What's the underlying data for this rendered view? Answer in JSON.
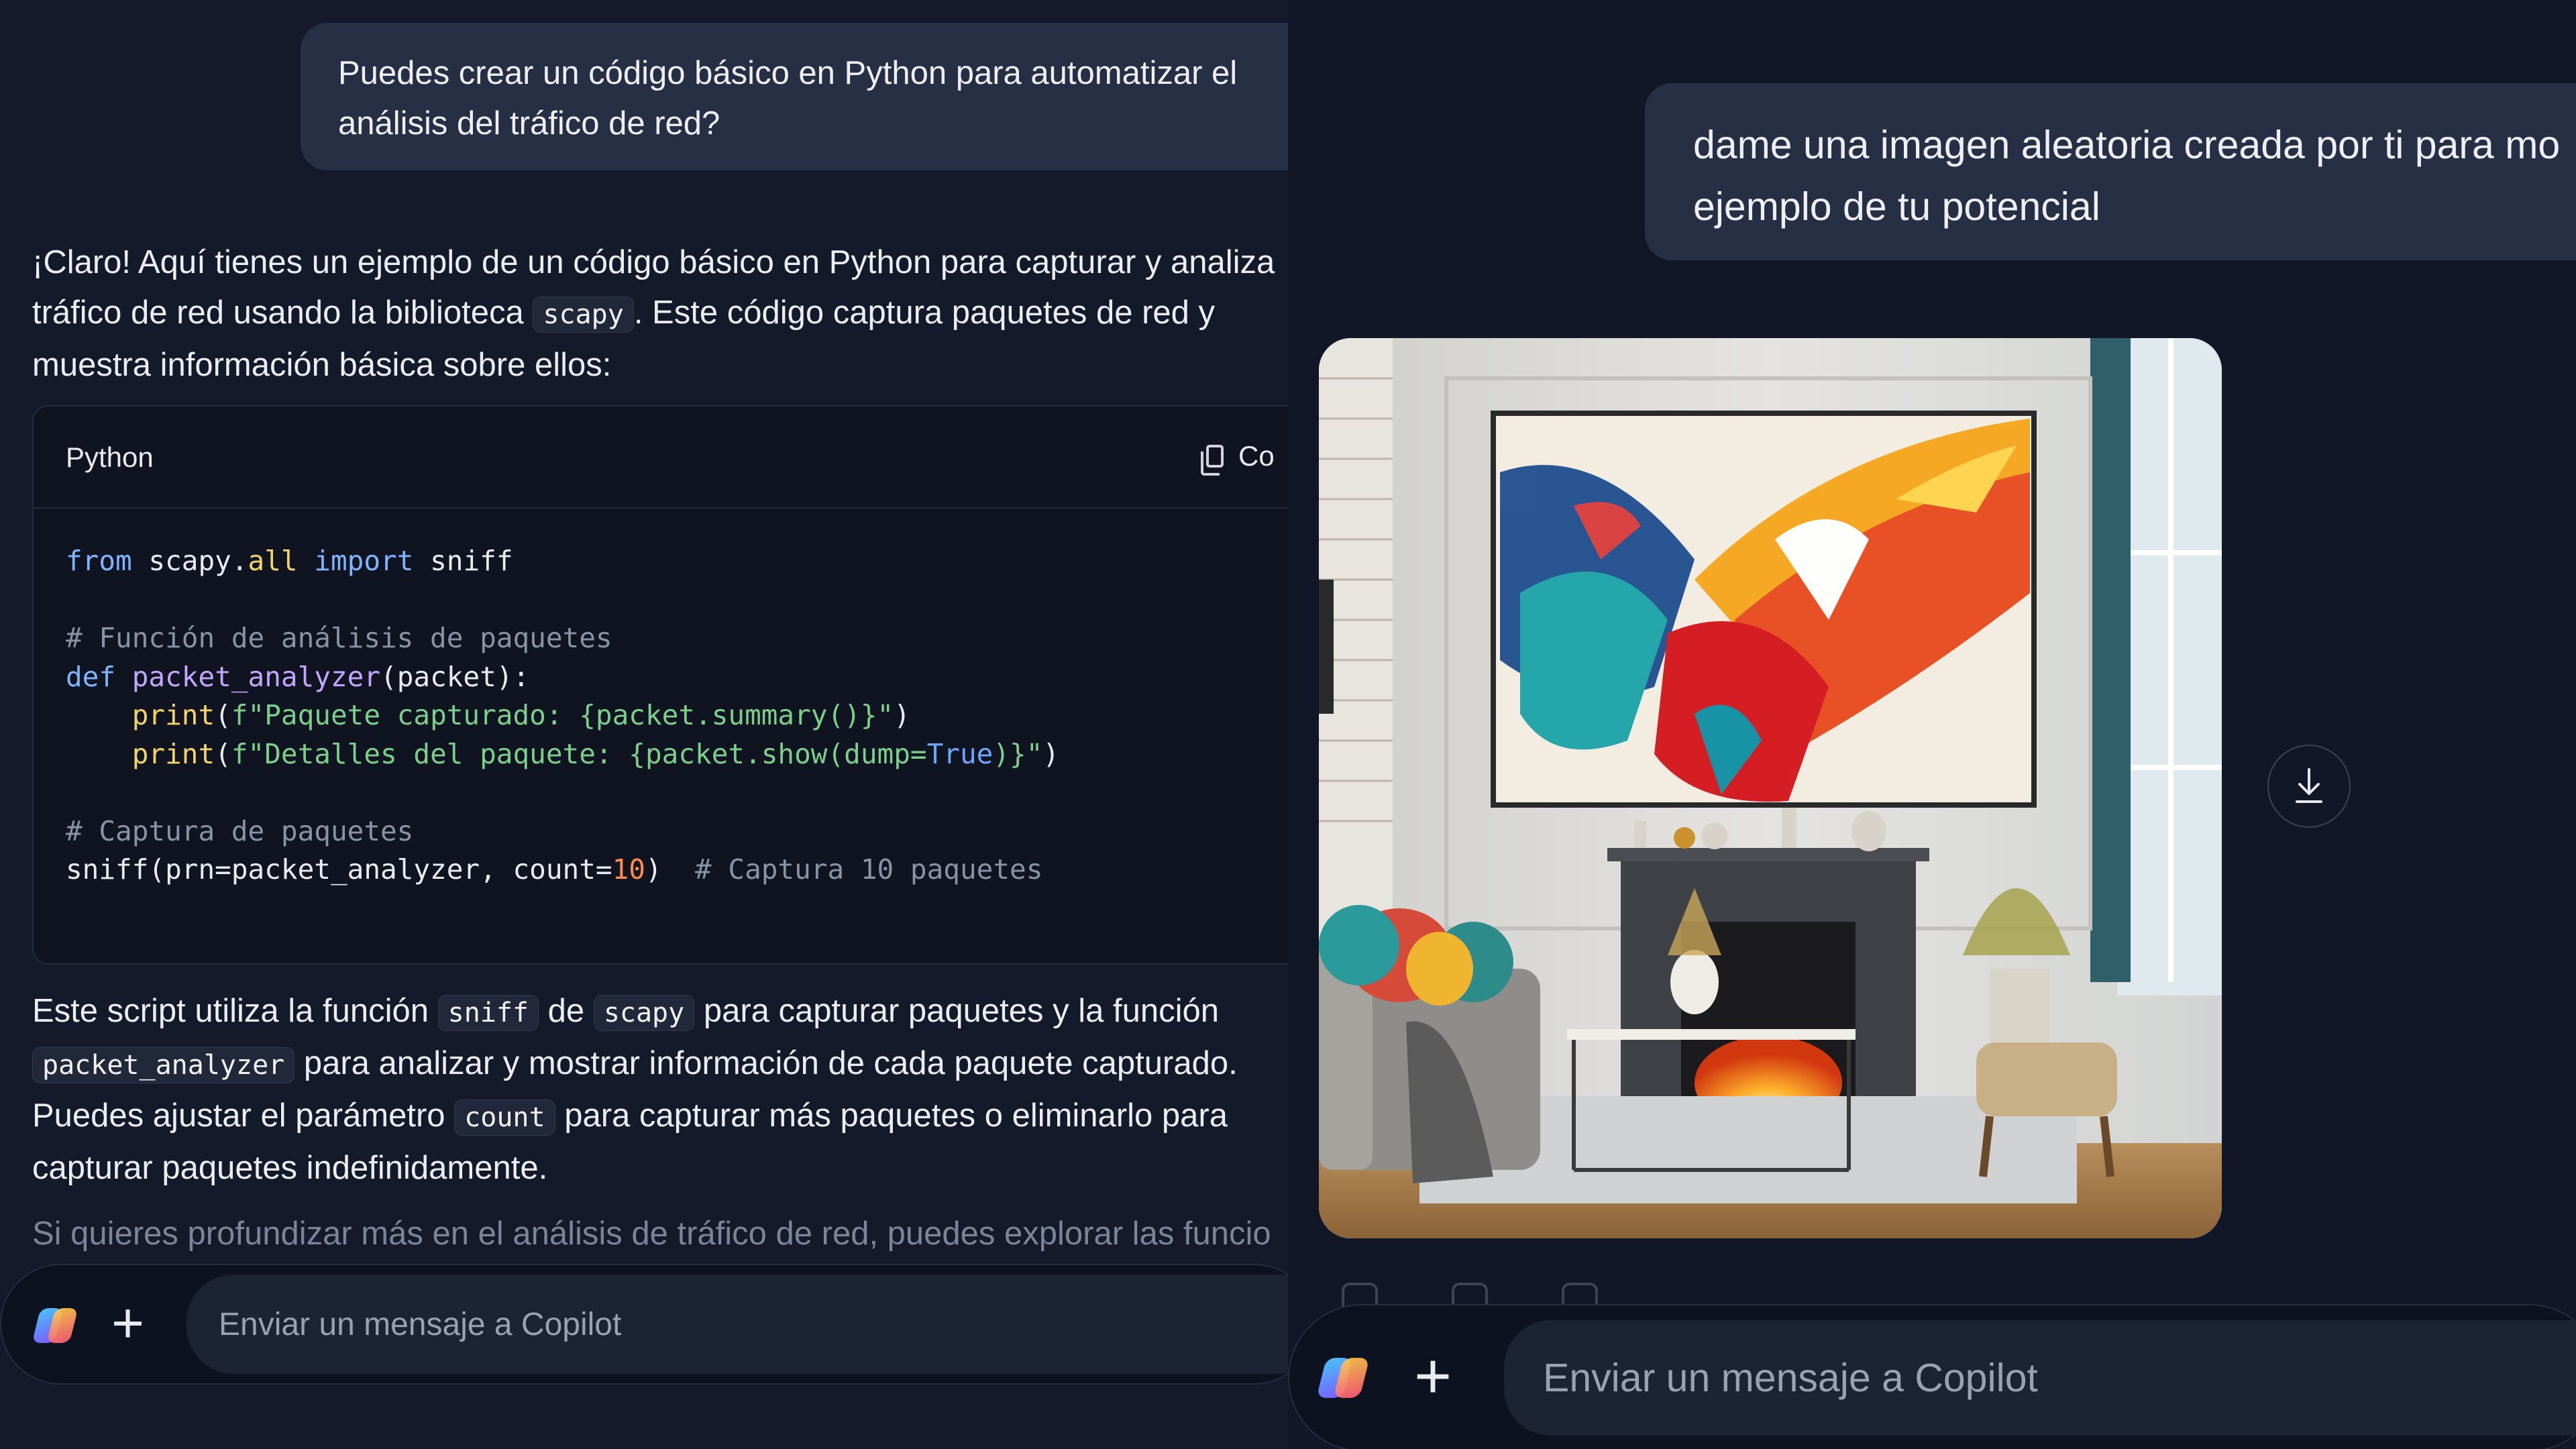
{
  "left": {
    "user_message_line1": "Puedes crear un código básico en Python para automatizar el",
    "user_message_line2": "análisis del tráfico de red?",
    "response": {
      "line1": "¡Claro! Aquí tienes un ejemplo de un código básico en Python para capturar y analiza",
      "line2_a": "tráfico de red usando la biblioteca",
      "line2_code": "scapy",
      "line2_b": ". Este código captura paquetes de red y",
      "line3": "muestra información básica sobre ellos:"
    },
    "code_block": {
      "language": "Python",
      "copy_label": "Co",
      "line1": {
        "k1": "from",
        "t1": " scapy.",
        "a1": "all",
        "t2": " ",
        "k2": "import",
        "t3": " sniff"
      },
      "comment1": "# Función de análisis de paquetes",
      "line_def": {
        "kw": "def",
        "fn": "packet_analyzer",
        "rest": "(packet):"
      },
      "line_print1": {
        "indent": "    ",
        "fn": "print",
        "p1": "(",
        "str": "f\"Paquete capturado: {packet.summary()}\"",
        "p2": ")"
      },
      "line_print2": {
        "indent": "    ",
        "fn": "print",
        "p1": "(",
        "str1": "f\"Detalles del paquete: {packet.show(dump=",
        "const": "True",
        "str2": ")}\"",
        "p2": ")"
      },
      "comment2": "# Captura de paquetes",
      "line_sniff": {
        "t1": "sniff(prn=packet_analyzer, count=",
        "num": "10",
        "t2": ")  ",
        "cm": "# Captura 10 paquetes"
      }
    },
    "explanation": {
      "l1_a": "Este script utiliza la función",
      "l1_code1": "sniff",
      "l1_b": "de",
      "l1_code2": "scapy",
      "l1_c": "para capturar paquetes y la función",
      "l2_code": "packet_analyzer",
      "l2_b": "para analizar y mostrar información de cada paquete capturado.",
      "l3_a": "Puedes ajustar el parámetro",
      "l3_code": "count",
      "l3_b": "para capturar más paquetes o eliminarlo para",
      "l4": "capturar paquetes indefinidamente."
    },
    "faded_text": "Si quieres profundizar más en el análisis de tráfico de red, puedes explorar las funcio",
    "composer": {
      "placeholder": "Enviar un mensaje a Copilot"
    }
  },
  "right": {
    "user_message_line1": "dame una imagen aleatoria creada por ti para mo",
    "user_message_line2": "ejemplo de tu potencial",
    "image": {
      "description_icon": "generated-living-room-painting"
    },
    "composer": {
      "placeholder": "Enviar un mensaje a Copilot"
    }
  },
  "icons": [
    "copilot-logo-icon",
    "plus-icon",
    "copy-icon",
    "download-icon"
  ]
}
